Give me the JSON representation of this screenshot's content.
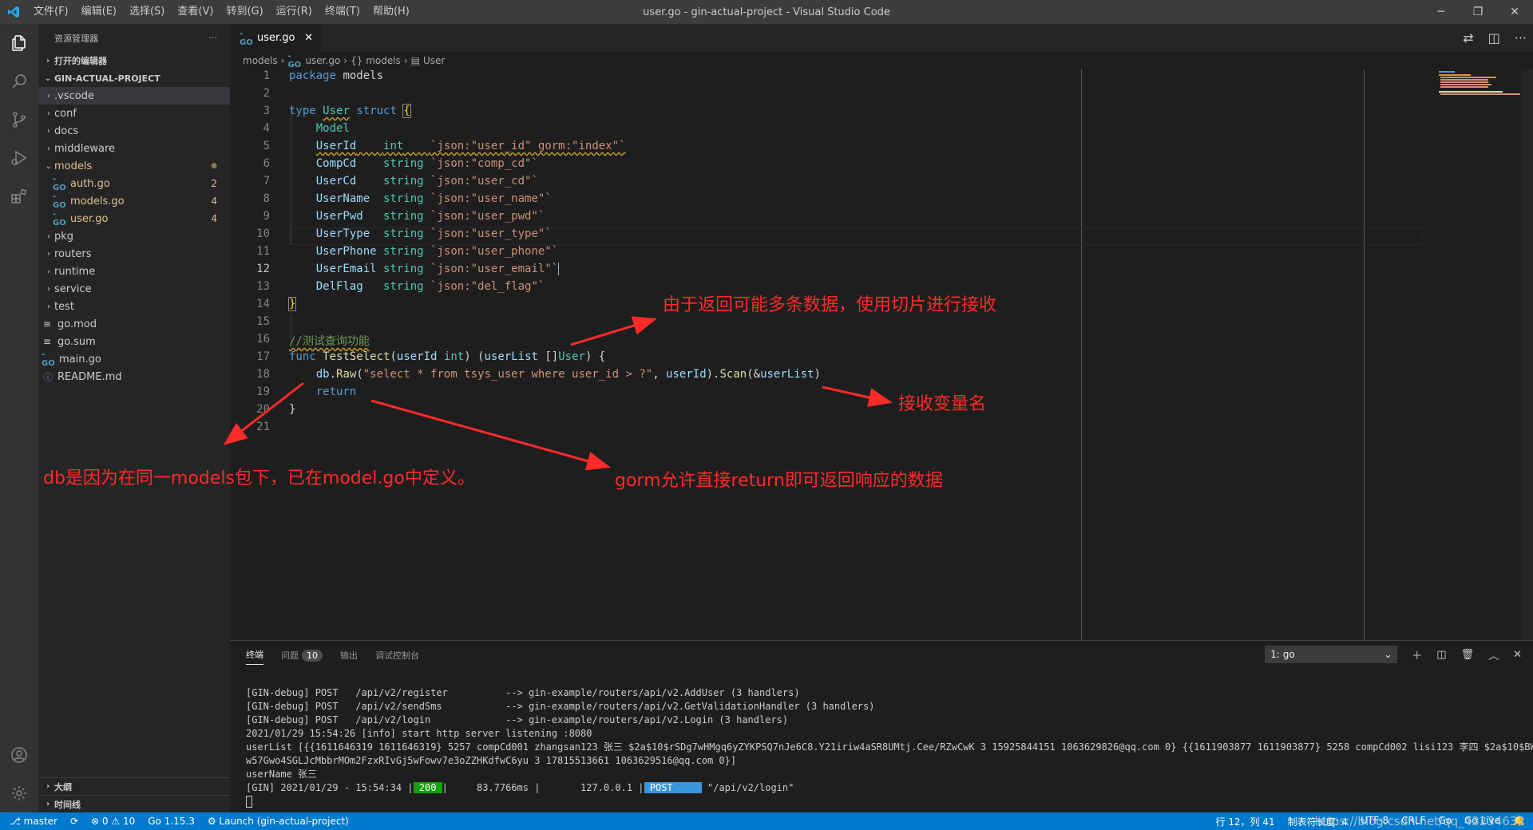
{
  "window": {
    "title": "user.go - gin-actual-project - Visual Studio Code",
    "menu": [
      "文件(F)",
      "编辑(E)",
      "选择(S)",
      "查看(V)",
      "转到(G)",
      "运行(R)",
      "终端(T)",
      "帮助(H)"
    ]
  },
  "sidebar": {
    "title": "资源管理器",
    "more": "···",
    "open_editors": "打开的编辑器",
    "project": "GIN-ACTUAL-PROJECT",
    "items": [
      {
        "label": ".vscode",
        "kind": "folder"
      },
      {
        "label": "conf",
        "kind": "folder"
      },
      {
        "label": "docs",
        "kind": "folder"
      },
      {
        "label": "middleware",
        "kind": "folder"
      },
      {
        "label": "models",
        "kind": "folder-open",
        "badge": "●"
      },
      {
        "label": "auth.go",
        "kind": "go",
        "badge": "2"
      },
      {
        "label": "models.go",
        "kind": "go",
        "badge": "4"
      },
      {
        "label": "user.go",
        "kind": "go",
        "badge": "4"
      },
      {
        "label": "pkg",
        "kind": "folder"
      },
      {
        "label": "routers",
        "kind": "folder"
      },
      {
        "label": "runtime",
        "kind": "folder"
      },
      {
        "label": "service",
        "kind": "folder"
      },
      {
        "label": "test",
        "kind": "folder"
      },
      {
        "label": "go.mod",
        "kind": "txt"
      },
      {
        "label": "go.sum",
        "kind": "txt"
      },
      {
        "label": "main.go",
        "kind": "go"
      },
      {
        "label": "README.md",
        "kind": "info"
      }
    ],
    "outline": "大纲",
    "timeline": "时间线"
  },
  "editor": {
    "tab": "user.go",
    "tab_close": "✕",
    "breadcrumb": [
      "models",
      "user.go",
      "{} models",
      "User"
    ],
    "current_line": 12
  },
  "panel": {
    "tabs": [
      "终端",
      "问题",
      "输出",
      "调试控制台"
    ],
    "problem_count": "10",
    "terminal_select": "1: go",
    "terminal": {
      "l1": "[GIN-debug] POST   /api/v2/register          --> gin-example/routers/api/v2.AddUser (3 handlers)",
      "l2": "[GIN-debug] POST   /api/v2/sendSms           --> gin-example/routers/api/v2.GetValidationHandler (3 handlers)",
      "l3": "[GIN-debug] POST   /api/v2/login             --> gin-example/routers/api/v2.Login (3 handlers)",
      "l4": "2021/01/29 15:54:26 [info] start http server listening :8080",
      "l5": "userList [{{1611646319 1611646319} 5257 compCd001 zhangsan123 张三 $2a$10$rSDg7wHMgq6yZYKPSQ7nJe6C8.Y21iriw4aSR8UMtj.Cee/RZwCwK 3 15925844151 1063629826@qq.com 0} {{1611903877 1611903877} 5258 compCd002 lisi123 李四 $2a$10$BWcQ",
      "l6": "w57Gwo4SGLJcMbbrMOm2FzxRIvGj5wFowv7e3oZZHKdfwC6yu 3 17815513661 1063629516@qq.com 0}]",
      "l7": "userName 张三",
      "l8a": "[GIN] 2021/01/29 - 15:54:34 |",
      "l8b": " 200 ",
      "l8c": "|     83.7766ms |       127.0.0.1 |",
      "l8d": " POST     ",
      "l8e": " \"/api/v2/login\""
    }
  },
  "statusbar": {
    "branch": "master",
    "sync": "⟳",
    "problems": "⊗ 0 ⚠ 10",
    "go_version": "Go 1.15.3",
    "launch": "Launch (gin-actual-project)",
    "position": "行 12，列 41",
    "tab_size": "制表符长度: 4",
    "encoding": "UTF-8",
    "eol": "CRLF",
    "language": "Go",
    "live": "Go Live"
  },
  "annotations": {
    "slice": "由于返回可能多条数据，使用切片进行接收",
    "varname": "接收变量名",
    "db": "db是因为在同一models包下，已在model.go中定义。",
    "gorm": "gorm允许直接return即可返回响应的数据"
  },
  "watermark": "https://blog.csdn.net/qq_43234632"
}
